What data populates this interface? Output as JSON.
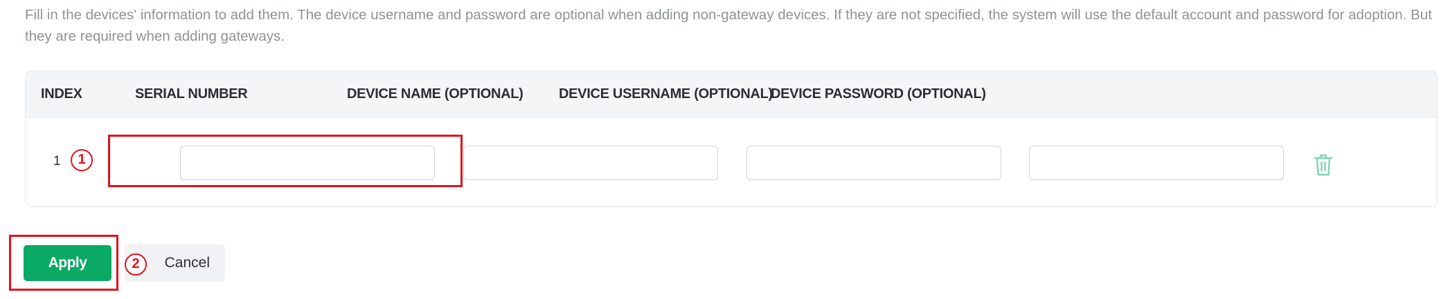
{
  "intro_text": "Fill in the devices' information to add them. The device username and password are optional when adding non-gateway devices. If they are not specified, the system will use the default account and password for adoption. But they are required when adding gateways.",
  "table": {
    "headers": [
      "INDEX",
      "SERIAL NUMBER",
      "DEVICE NAME (OPTIONAL)",
      "DEVICE USERNAME (OPTIONAL)",
      "DEVICE PASSWORD (OPTIONAL)"
    ],
    "rows": [
      {
        "index": "1",
        "serial_number": "",
        "device_name": "",
        "device_username": "",
        "device_password": ""
      }
    ]
  },
  "buttons": {
    "apply": "Apply",
    "cancel": "Cancel"
  },
  "annotations": {
    "step1": "1",
    "step2": "2"
  },
  "icons": {
    "delete": "trash-icon"
  },
  "colors": {
    "primary": "#0aaa64",
    "annotation": "#e3101a",
    "header_bg": "#f4f5f6",
    "trash": "#7fd4ae"
  }
}
